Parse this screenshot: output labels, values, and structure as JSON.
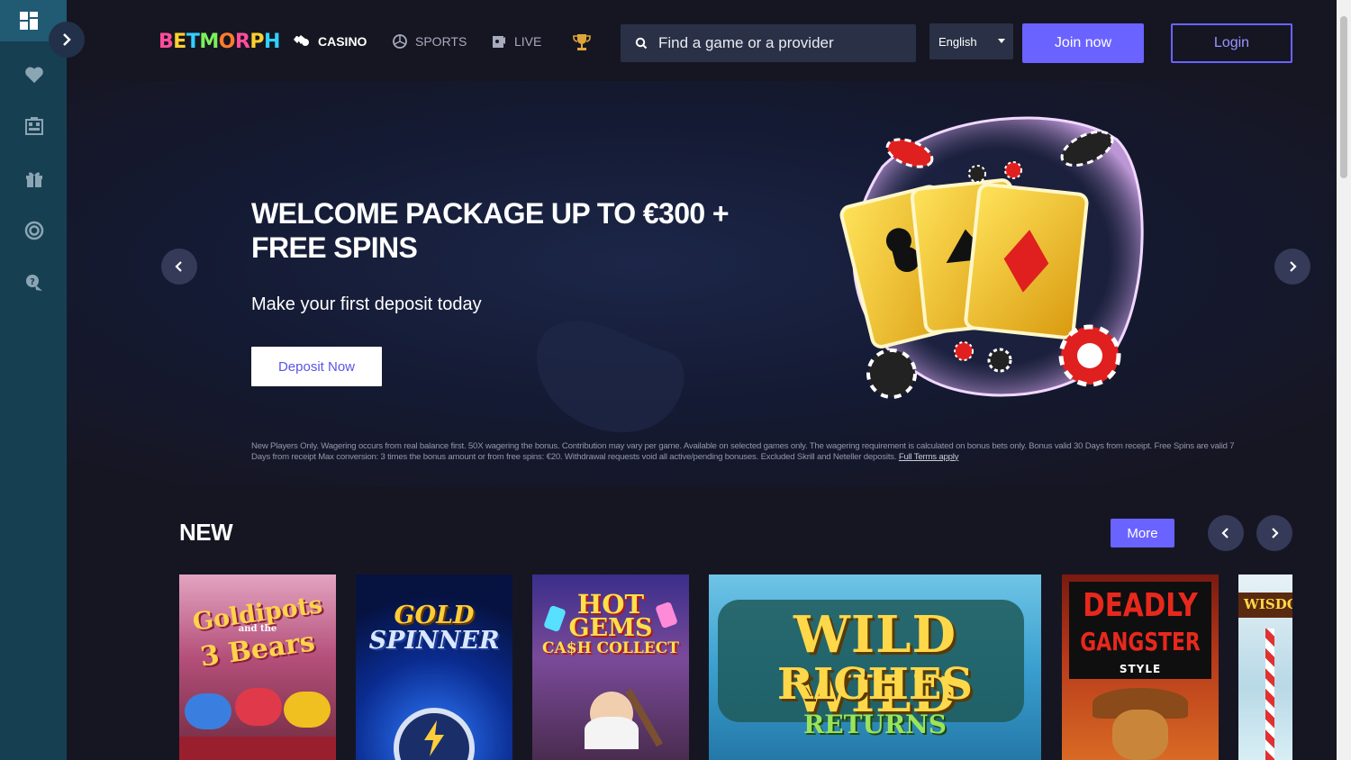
{
  "header": {
    "logo": "BETMORPH",
    "nav": [
      {
        "label": "CASINO",
        "icon": "cards-icon",
        "active": true
      },
      {
        "label": "SPORTS",
        "icon": "ball-icon",
        "active": false
      },
      {
        "label": "LIVE",
        "icon": "live-icon",
        "active": false
      },
      {
        "label": "",
        "icon": "trophy-icon",
        "active": false
      }
    ],
    "search_placeholder": "Find a game or a provider",
    "language": "English",
    "join_label": "Join now",
    "login_label": "Login"
  },
  "sidebar": {
    "items": [
      "dashboard-icon",
      "heart-icon",
      "casino-building-icon",
      "gift-icon",
      "target-icon",
      "support-icon"
    ]
  },
  "banner": {
    "headline": "WELCOME PACKAGE UP TO €300 + FREE SPINS",
    "subtitle": "Make your first deposit today",
    "cta": "Deposit Now",
    "terms": "New Players Only. Wagering occurs from real balance first. 50X wagering the bonus. Contribution may vary per game. Available on selected games only. The wagering requirement is calculated on bonus bets only. Bonus valid 30 Days from receipt. Free Spins are valid 7 Days from receipt Max conversion: 3 times the bonus amount or from free spins: €20. Withdrawal requests void all active/pending bonuses. Excluded Skrill and Neteller deposits.",
    "terms_link": "Full Terms apply"
  },
  "new_section": {
    "title": "NEW",
    "more_label": "More",
    "games": [
      {
        "line1": "Goldipots",
        "line2": "and the",
        "line3": "3 Bears"
      },
      {
        "line1": "GOLD",
        "line2": "SPINNER"
      },
      {
        "line1": "HOT",
        "line2": "GEMS",
        "line3": "CA$H COLLECT"
      },
      {
        "line1": "WILD WILD",
        "line2": "RICHES",
        "line3": "RETURNS"
      },
      {
        "line1": "DEADLY",
        "line2": "GANGSTER",
        "line3": "STYLE"
      },
      {
        "line1": "WISDO"
      }
    ]
  }
}
